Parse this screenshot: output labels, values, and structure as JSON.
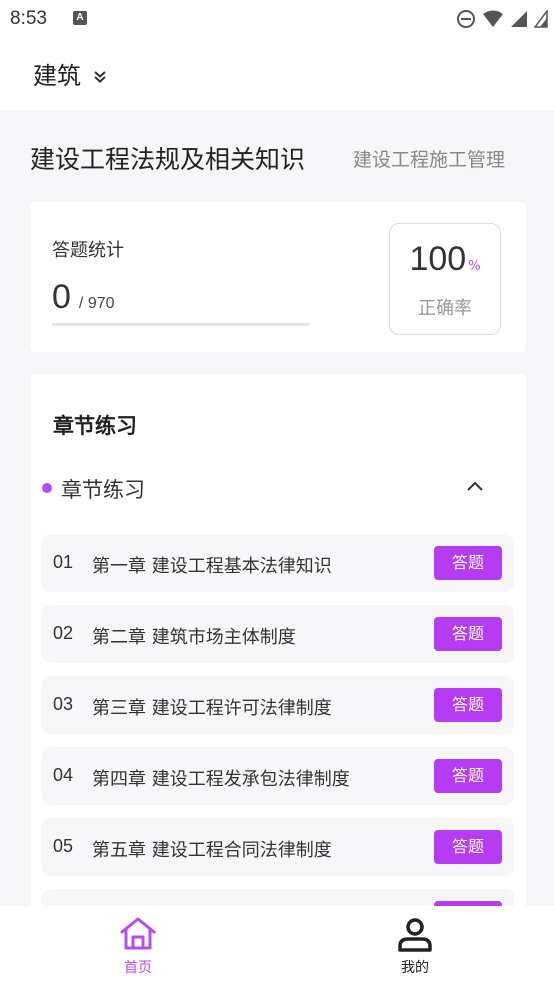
{
  "status_bar": {
    "time": "8:53",
    "notification_icon": "A",
    "icons": [
      "do-not-disturb-icon",
      "wifi-icon",
      "signal-icon",
      "signal-icon"
    ]
  },
  "header": {
    "subject": "建筑",
    "subject_icon": "double-chevron-down-icon"
  },
  "course_tabs": [
    {
      "label": "建设工程法规及相关知识",
      "active": true
    },
    {
      "label": "建设工程施工管理",
      "active": false
    }
  ],
  "stats": {
    "title": "答题统计",
    "answered": "0",
    "total": "/ 970",
    "progress": 0,
    "accuracy_value": "100",
    "accuracy_unit": "%",
    "accuracy_label": "正确率"
  },
  "chapters": {
    "section_title": "章节练习",
    "group_label": "章节练习",
    "group_icon": "chevron-up-icon",
    "items": [
      {
        "num": "01",
        "title": "第一章  建设工程基本法律知识",
        "action": "答题"
      },
      {
        "num": "02",
        "title": "第二章  建筑市场主体制度",
        "action": "答题"
      },
      {
        "num": "03",
        "title": "第三章  建设工程许可法律制度",
        "action": "答题"
      },
      {
        "num": "04",
        "title": "第四章  建设工程发承包法律制度",
        "action": "答题"
      },
      {
        "num": "05",
        "title": "第五章  建设工程合同法律制度",
        "action": "答题"
      },
      {
        "num": "",
        "title": "",
        "action": ""
      }
    ]
  },
  "bottom_nav": [
    {
      "label": "首页",
      "icon": "home-icon",
      "active": true
    },
    {
      "label": "我的",
      "icon": "user-icon",
      "active": false
    }
  ],
  "colors": {
    "accent": "#b44cf0",
    "button": "#b53cf2",
    "background": "#f6f6f8"
  }
}
